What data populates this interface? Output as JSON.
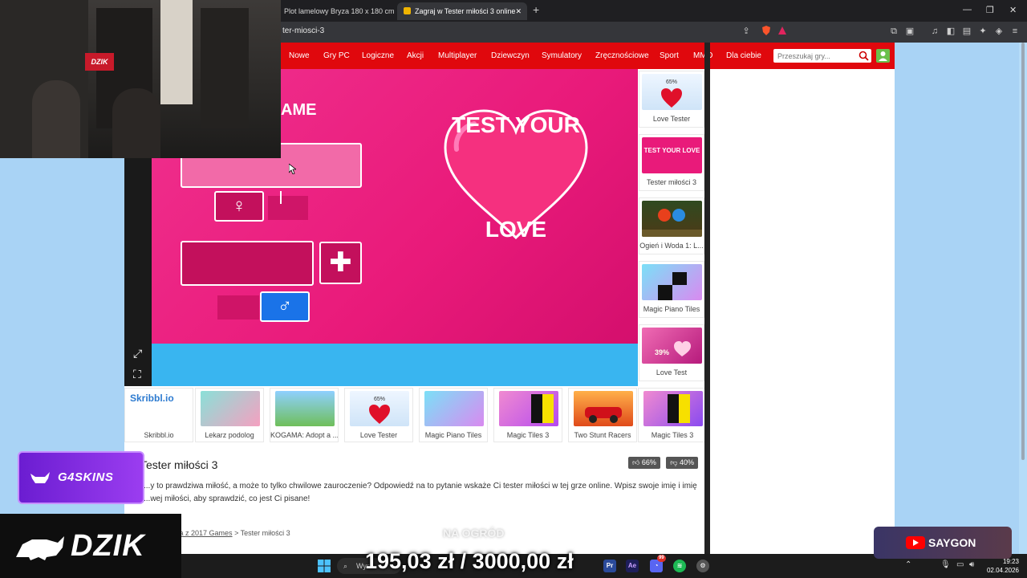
{
  "tabs": [
    {
      "title": "Plot lamelowy Bryza 180 x 180 cm"
    },
    {
      "title": "Zagraj w Tester miłości 3 online"
    }
  ],
  "address_bar": {
    "url": "ter-miosci-3"
  },
  "nav": {
    "links": [
      "Nowe",
      "Gry PC",
      "Logiczne",
      "Akcji",
      "Multiplayer",
      "Dziewczyn",
      "Symulatory",
      "Zręcznościowe",
      "Sport",
      "MMO",
      "Dla ciebie"
    ],
    "search_placeholder": "Przeszukaj gry..."
  },
  "game": {
    "name_label": "AME",
    "title_top": "TEST YOUR",
    "title_bottom": "LOVE",
    "female_symbol": "♀",
    "male_symbol": "♂",
    "plus_symbol": "✚"
  },
  "sidebar_games": [
    {
      "label": "Love Tester",
      "thumb_text": "65%"
    },
    {
      "label": "Tester miłości 3",
      "thumb_text": "TEST YOUR LOVE"
    },
    {
      "label": "Ogień i Woda 1: L...",
      "thumb_text": ""
    },
    {
      "label": "Magic Piano Tiles",
      "thumb_text": ""
    },
    {
      "label": "Love Test",
      "thumb_text": "39%"
    }
  ],
  "row_games": [
    {
      "label": "Skribbl.io",
      "thumb_text": "Skribbl.io"
    },
    {
      "label": "Lekarz podolog",
      "thumb_text": ""
    },
    {
      "label": "KOGAMA: Adopt a ...",
      "thumb_text": ""
    },
    {
      "label": "Love Tester",
      "thumb_text": "65%"
    },
    {
      "label": "Magic Piano Tiles",
      "thumb_text": ""
    },
    {
      "label": "Magic Tiles 3",
      "thumb_text": ""
    },
    {
      "label": "Two Stunt Racers",
      "thumb_text": ""
    },
    {
      "label": "Magic Tiles 3",
      "thumb_text": ""
    }
  ],
  "description": {
    "title": "Tester miłości 3",
    "likes": "66%",
    "dislikes": "40%",
    "text": "...y to prawdziwa miłość, a może to tylko chwilowe zauroczenie? Odpowiedź na to pytanie wskaże Ci tester miłości w tej grze online. Wpisz swoje imię i imię ...wej miłości, aby sprawdzić, co jest Ci pisane!",
    "breadcrumb_link": "za z 2017 Games",
    "breadcrumb_sep": ">",
    "breadcrumb_current": "Tester miłości 3"
  },
  "overlays": {
    "g4skins": "G4SKINS",
    "dzik": "DZIK",
    "money": "195,03 zł / 3000,00 zł",
    "na_ogrod": "NA OGRÓD",
    "saygon": "SAYGON",
    "webcam_sign": "DZIK"
  },
  "taskbar": {
    "search_text": "Wys",
    "time": "19:23",
    "date": "02.04.2026",
    "discord_badge": "99"
  },
  "colors": {
    "nav_red": "#e0080d",
    "game_pink": "#e91a7a",
    "game_blue": "#39b5f0",
    "male_blue": "#1a73e8"
  }
}
